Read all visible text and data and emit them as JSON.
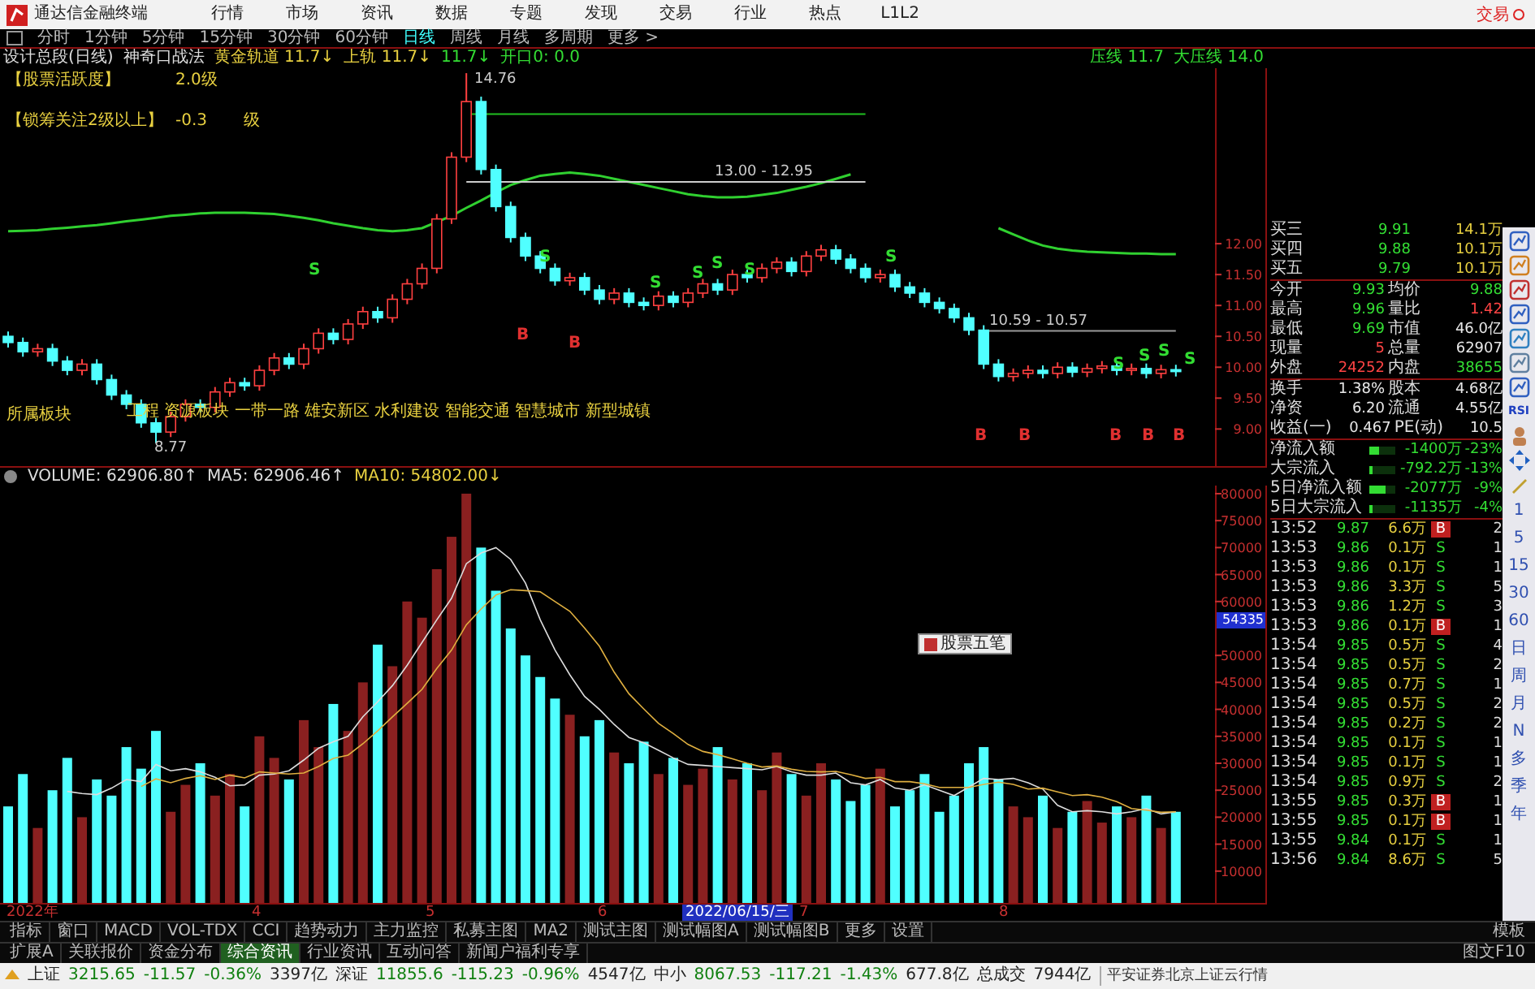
{
  "app": {
    "title": "通达信金融终端",
    "menu": [
      "行情",
      "市场",
      "资讯",
      "数据",
      "专题",
      "发现",
      "交易",
      "行业",
      "热点",
      "L1L2"
    ],
    "trade_button": "交易"
  },
  "periods": [
    {
      "label": "分时",
      "selected": false
    },
    {
      "label": "1分钟",
      "selected": false
    },
    {
      "label": "5分钟",
      "selected": false
    },
    {
      "label": "15分钟",
      "selected": false
    },
    {
      "label": "30分钟",
      "selected": false
    },
    {
      "label": "60分钟",
      "selected": false
    },
    {
      "label": "日线",
      "selected": true
    },
    {
      "label": "周线",
      "selected": false
    },
    {
      "label": "月线",
      "selected": false
    },
    {
      "label": "多周期",
      "selected": false
    },
    {
      "label": "更多 >",
      "selected": false
    }
  ],
  "indicator_bar": [
    {
      "label": "设计总段(日线)",
      "kind": "plain"
    },
    {
      "label": "神奇口战法",
      "kind": "plain"
    },
    {
      "label": "黄金轨道",
      "value": "11.7↓",
      "kind": "gold"
    },
    {
      "label": "上轨",
      "value": "11.7↓",
      "kind": "gold"
    },
    {
      "value": "11.7↓",
      "kind": "green"
    },
    {
      "label": "开口0:",
      "value": "0.0",
      "kind": "green"
    },
    {
      "label": "压线",
      "value": "11.7",
      "kind": "green-right"
    },
    {
      "label": "大压线",
      "value": "14.0",
      "kind": "green"
    }
  ],
  "notes": [
    {
      "label": "【股票活跃度】",
      "value": "2.0级"
    },
    {
      "label": "【锁筹关注2级以上】",
      "value": "-0.3",
      "unit": "级"
    }
  ],
  "price_chart": {
    "annotations": [
      "14.76",
      "13.00 - 12.95",
      "10.59 - 10.57",
      "8.77"
    ],
    "signals": [
      {
        "text": "S",
        "kind": "sell"
      },
      {
        "text": "S",
        "kind": "sell"
      },
      {
        "text": "S",
        "kind": "sell"
      },
      {
        "text": "S",
        "kind": "sell"
      },
      {
        "text": "S",
        "kind": "sell"
      },
      {
        "text": "S",
        "kind": "sell"
      },
      {
        "text": "S",
        "kind": "sell"
      },
      {
        "text": "S",
        "kind": "sell"
      },
      {
        "text": "S",
        "kind": "sell"
      },
      {
        "text": "S",
        "kind": "sell"
      },
      {
        "text": "S",
        "kind": "sell"
      },
      {
        "text": "B",
        "kind": "buy"
      },
      {
        "text": "B",
        "kind": "buy"
      },
      {
        "text": "B",
        "kind": "buy"
      },
      {
        "text": "B",
        "kind": "buy"
      },
      {
        "text": "B",
        "kind": "buy"
      },
      {
        "text": "B",
        "kind": "buy"
      },
      {
        "text": "B",
        "kind": "buy"
      }
    ],
    "concepts": {
      "label": "所属板块",
      "items": [
        "工程",
        "资源板块",
        "一带一路",
        "雄安新区",
        "水利建设",
        "智能交通",
        "智慧城市",
        "新型城镇"
      ]
    },
    "chart_data": {
      "type": "candlestick",
      "ylim": [
        8.4,
        14.84
      ],
      "series": [
        {
          "type": "line",
          "color": "#30d030",
          "values": [
            12.2,
            12.21,
            12.22,
            12.24,
            12.26,
            12.28,
            12.3,
            12.33,
            12.36,
            12.39,
            12.42,
            12.45,
            12.47,
            12.49,
            12.5,
            12.5,
            12.5,
            12.49,
            12.48,
            12.45,
            12.42,
            12.38,
            12.33,
            12.29,
            12.25,
            12.22,
            12.2,
            12.22,
            12.25,
            12.35,
            12.45,
            12.58,
            12.7,
            12.83,
            12.95,
            13.03,
            13.1,
            13.13,
            13.15,
            13.13,
            13.1,
            13.05,
            13.0,
            12.95,
            12.9,
            12.85,
            12.8,
            12.77,
            12.75,
            12.75,
            12.76,
            12.79,
            12.82,
            12.87,
            12.92,
            12.98,
            13.05,
            13.12,
            null,
            null,
            null,
            null,
            null,
            null,
            null,
            null,
            null,
            12.25,
            12.15,
            12.05,
            11.97,
            11.92,
            11.89,
            11.87,
            11.86,
            11.85,
            11.84,
            11.84,
            11.83,
            11.83
          ]
        },
        {
          "type": "line",
          "color": "#20c020",
          "values": [
            null,
            null,
            null,
            null,
            null,
            null,
            null,
            null,
            null,
            null,
            null,
            null,
            null,
            null,
            null,
            null,
            null,
            null,
            null,
            null,
            null,
            null,
            null,
            null,
            null,
            null,
            null,
            null,
            null,
            null,
            null,
            14.1,
            14.1,
            14.1,
            14.1,
            14.1,
            14.1,
            14.1,
            14.1,
            14.1,
            14.1,
            14.1,
            14.1,
            14.1,
            14.1,
            14.1,
            14.1,
            14.1,
            14.1,
            14.1,
            14.1,
            14.1,
            14.1,
            14.1,
            14.1,
            14.1,
            14.1,
            14.1,
            14.1,
            null,
            null,
            null,
            null,
            null,
            null,
            null,
            null,
            null,
            null,
            null,
            null,
            null,
            null,
            null,
            null,
            null,
            null,
            null,
            null,
            null
          ]
        },
        {
          "type": "line",
          "color": "#cccccc",
          "values": [
            null,
            null,
            null,
            null,
            null,
            null,
            null,
            null,
            null,
            null,
            null,
            null,
            null,
            null,
            null,
            null,
            null,
            null,
            null,
            null,
            null,
            null,
            null,
            null,
            null,
            null,
            null,
            null,
            null,
            null,
            null,
            13.0,
            13.0,
            13.0,
            13.0,
            13.0,
            13.0,
            13.0,
            13.0,
            13.0,
            13.0,
            13.0,
            13.0,
            13.0,
            13.0,
            13.0,
            13.0,
            13.0,
            13.0,
            13.0,
            13.0,
            13.0,
            13.0,
            13.0,
            13.0,
            13.0,
            13.0,
            13.0,
            13.0,
            null,
            null,
            null,
            null,
            null,
            null,
            null,
            null,
            null,
            null,
            null,
            null,
            null,
            null,
            null,
            null,
            null,
            null,
            null,
            null,
            null
          ]
        },
        {
          "type": "line",
          "color": "#999999",
          "values": [
            null,
            null,
            null,
            null,
            null,
            null,
            null,
            null,
            null,
            null,
            null,
            null,
            null,
            null,
            null,
            null,
            null,
            null,
            null,
            null,
            null,
            null,
            null,
            null,
            null,
            null,
            null,
            null,
            null,
            null,
            null,
            null,
            null,
            null,
            null,
            null,
            null,
            null,
            null,
            null,
            null,
            null,
            null,
            null,
            null,
            null,
            null,
            null,
            null,
            null,
            null,
            null,
            null,
            null,
            null,
            null,
            null,
            null,
            null,
            null,
            null,
            null,
            null,
            null,
            null,
            null,
            10.59,
            10.59,
            10.59,
            10.59,
            10.59,
            10.59,
            10.59,
            10.59,
            10.59,
            10.59,
            10.59,
            10.59,
            10.59,
            10.59
          ]
        }
      ],
      "yticks": [
        {
          "value": 12,
          "label": "12.00"
        },
        {
          "value": 11.5,
          "label": "11.50"
        },
        {
          "value": 11,
          "label": "11.00"
        },
        {
          "value": 10.5,
          "label": "10.50"
        },
        {
          "value": 10,
          "label": "10.00"
        },
        {
          "value": 9.5,
          "label": "9.50"
        },
        {
          "value": 9,
          "label": "9.00"
        }
      ],
      "ohlc": [
        [
          10.5,
          10.58,
          10.32,
          10.4
        ],
        [
          10.4,
          10.48,
          10.17,
          10.25
        ],
        [
          10.25,
          10.38,
          10.17,
          10.3
        ],
        [
          10.3,
          10.38,
          10.02,
          10.1
        ],
        [
          10.1,
          10.18,
          9.87,
          9.95
        ],
        [
          9.95,
          10.13,
          9.87,
          10.05
        ],
        [
          10.05,
          10.13,
          9.72,
          9.8
        ],
        [
          9.8,
          9.88,
          9.47,
          9.55
        ],
        [
          9.55,
          9.63,
          9.32,
          9.4
        ],
        [
          9.4,
          9.48,
          9.02,
          9.1
        ],
        [
          9.1,
          9.18,
          8.77,
          8.95
        ],
        [
          8.95,
          9.28,
          8.87,
          9.2
        ],
        [
          9.2,
          9.48,
          9.12,
          9.4
        ],
        [
          9.4,
          9.48,
          9.27,
          9.35
        ],
        [
          9.35,
          9.68,
          9.27,
          9.6
        ],
        [
          9.6,
          9.83,
          9.52,
          9.75
        ],
        [
          9.75,
          9.83,
          9.62,
          9.7
        ],
        [
          9.7,
          10.03,
          9.62,
          9.95
        ],
        [
          9.95,
          10.23,
          9.87,
          10.15
        ],
        [
          10.15,
          10.23,
          9.97,
          10.05
        ],
        [
          10.05,
          10.38,
          9.97,
          10.3
        ],
        [
          10.3,
          10.63,
          10.22,
          10.55
        ],
        [
          10.55,
          10.63,
          10.37,
          10.45
        ],
        [
          10.45,
          10.78,
          10.37,
          10.7
        ],
        [
          10.7,
          10.98,
          10.62,
          10.9
        ],
        [
          10.9,
          10.98,
          10.72,
          10.8
        ],
        [
          10.8,
          11.18,
          10.72,
          11.1
        ],
        [
          11.1,
          11.43,
          11.02,
          11.35
        ],
        [
          11.35,
          11.68,
          11.27,
          11.6
        ],
        [
          11.6,
          12.48,
          11.52,
          12.4
        ],
        [
          12.4,
          13.48,
          12.32,
          13.4
        ],
        [
          13.4,
          14.76,
          13.32,
          14.3
        ],
        [
          14.3,
          14.38,
          13.12,
          13.2
        ],
        [
          13.2,
          13.28,
          12.52,
          12.6
        ],
        [
          12.6,
          12.68,
          12.02,
          12.1
        ],
        [
          12.1,
          12.18,
          11.72,
          11.8
        ],
        [
          11.8,
          11.88,
          11.52,
          11.6
        ],
        [
          11.6,
          11.68,
          11.32,
          11.4
        ],
        [
          11.4,
          11.53,
          11.32,
          11.45
        ],
        [
          11.45,
          11.53,
          11.17,
          11.25
        ],
        [
          11.25,
          11.33,
          11.02,
          11.1
        ],
        [
          11.1,
          11.28,
          11.02,
          11.2
        ],
        [
          11.2,
          11.28,
          10.97,
          11.05
        ],
        [
          11.05,
          11.13,
          10.92,
          11.0
        ],
        [
          11.0,
          11.23,
          10.92,
          11.15
        ],
        [
          11.15,
          11.23,
          10.97,
          11.05
        ],
        [
          11.05,
          11.28,
          10.97,
          11.2
        ],
        [
          11.2,
          11.43,
          11.12,
          11.35
        ],
        [
          11.35,
          11.43,
          11.17,
          11.25
        ],
        [
          11.25,
          11.58,
          11.17,
          11.5
        ],
        [
          11.5,
          11.58,
          11.37,
          11.45
        ],
        [
          11.45,
          11.68,
          11.37,
          11.6
        ],
        [
          11.6,
          11.78,
          11.52,
          11.7
        ],
        [
          11.7,
          11.78,
          11.47,
          11.55
        ],
        [
          11.55,
          11.88,
          11.47,
          11.8
        ],
        [
          11.8,
          11.98,
          11.72,
          11.9
        ],
        [
          11.9,
          11.98,
          11.67,
          11.75
        ],
        [
          11.75,
          11.83,
          11.52,
          11.6
        ],
        [
          11.6,
          11.68,
          11.37,
          11.45
        ],
        [
          11.45,
          11.58,
          11.37,
          11.5
        ],
        [
          11.5,
          11.58,
          11.22,
          11.3
        ],
        [
          11.3,
          11.38,
          11.12,
          11.2
        ],
        [
          11.2,
          11.28,
          10.97,
          11.05
        ],
        [
          11.05,
          11.13,
          10.87,
          10.95
        ],
        [
          10.95,
          11.03,
          10.72,
          10.8
        ],
        [
          10.8,
          10.88,
          10.52,
          10.6
        ],
        [
          10.6,
          10.68,
          9.97,
          10.05
        ],
        [
          10.05,
          10.13,
          9.77,
          9.85
        ],
        [
          9.85,
          9.98,
          9.77,
          9.9
        ],
        [
          9.9,
          10.03,
          9.82,
          9.95
        ],
        [
          9.95,
          10.03,
          9.82,
          9.9
        ],
        [
          9.9,
          10.08,
          9.82,
          10.0
        ],
        [
          10.0,
          10.08,
          9.84,
          9.92
        ],
        [
          9.92,
          10.06,
          9.84,
          9.98
        ],
        [
          9.98,
          10.1,
          9.9,
          10.02
        ],
        [
          10.02,
          10.1,
          9.87,
          9.95
        ],
        [
          9.95,
          10.06,
          9.87,
          9.98
        ],
        [
          9.98,
          10.06,
          9.82,
          9.9
        ],
        [
          9.9,
          10.04,
          9.82,
          9.96
        ],
        [
          9.96,
          10.04,
          9.85,
          9.93
        ]
      ]
    }
  },
  "volume": {
    "header": [
      {
        "value": "62906.80↑",
        "kind": "plain"
      },
      {
        "value": "62906.46↑",
        "kind": "plain"
      },
      {
        "value": "54802.00↓",
        "kind": "gold"
      }
    ],
    "chart_data": {
      "type": "bar",
      "yticks": [
        {
          "value": 80000,
          "label": "80000"
        },
        {
          "value": 75000,
          "label": "75000"
        },
        {
          "value": 70000,
          "label": "70000"
        },
        {
          "value": 65000,
          "label": "65000"
        },
        {
          "value": 60000,
          "label": "60000"
        },
        {
          "value": 50000,
          "label": "50000"
        },
        {
          "value": 45000,
          "label": "45000"
        },
        {
          "value": 40000,
          "label": "40000"
        },
        {
          "value": 35000,
          "label": "35000"
        },
        {
          "value": 30000,
          "label": "30000"
        },
        {
          "value": 25000,
          "label": "25000"
        },
        {
          "value": 20000,
          "label": "20000"
        },
        {
          "value": 15000,
          "label": "15000"
        },
        {
          "value": 10000,
          "label": "10000"
        }
      ],
      "ylim": [
        4100,
        81500
      ],
      "categories": [
        null,
        null,
        null,
        null,
        null,
        null,
        null,
        null,
        null,
        null,
        null,
        null,
        null,
        null,
        null,
        null,
        null,
        null,
        null,
        null,
        null,
        null,
        null,
        null,
        null,
        null,
        null,
        null,
        null,
        null,
        null,
        null,
        null,
        null,
        null,
        null,
        null,
        null,
        null,
        null,
        null,
        null,
        null,
        null,
        null,
        null,
        null,
        null,
        null,
        null,
        null,
        null,
        null,
        null,
        null,
        null,
        null,
        null,
        null,
        null,
        null,
        null,
        null,
        null,
        null,
        null,
        null,
        null,
        null,
        null,
        null,
        null,
        null,
        null,
        null,
        null,
        null,
        null,
        null,
        null
      ],
      "series": [
        {
          "name": "VOLUME:",
          "type": "bar",
          "colors": [
            "#50ffff",
            "#50ffff",
            "#8a2020",
            "#50ffff",
            "#50ffff",
            "#8a2020",
            "#50ffff",
            "#50ffff",
            "#50ffff",
            "#50ffff",
            "#50ffff",
            "#8a2020",
            "#8a2020",
            "#50ffff",
            "#8a2020",
            "#8a2020",
            "#50ffff",
            "#8a2020",
            "#8a2020",
            "#50ffff",
            "#8a2020",
            "#8a2020",
            "#50ffff",
            "#8a2020",
            "#8a2020",
            "#50ffff",
            "#8a2020",
            "#8a2020",
            "#8a2020",
            "#8a2020",
            "#8a2020",
            "#8a2020",
            "#50ffff",
            "#50ffff",
            "#50ffff",
            "#50ffff",
            "#50ffff",
            "#50ffff",
            "#8a2020",
            "#50ffff",
            "#50ffff",
            "#8a2020",
            "#50ffff",
            "#50ffff",
            "#8a2020",
            "#50ffff",
            "#8a2020",
            "#8a2020",
            "#50ffff",
            "#8a2020",
            "#50ffff",
            "#8a2020",
            "#8a2020",
            "#50ffff",
            "#8a2020",
            "#8a2020",
            "#50ffff",
            "#50ffff",
            "#50ffff",
            "#8a2020",
            "#50ffff",
            "#50ffff",
            "#50ffff",
            "#50ffff",
            "#50ffff",
            "#50ffff",
            "#50ffff",
            "#50ffff",
            "#8a2020",
            "#8a2020",
            "#50ffff",
            "#8a2020",
            "#50ffff",
            "#8a2020",
            "#8a2020",
            "#50ffff",
            "#8a2020",
            "#50ffff",
            "#8a2020",
            "#50ffff"
          ],
          "values": [
            22000,
            28000,
            18000,
            25000,
            31000,
            20000,
            27000,
            24000,
            33000,
            29000,
            36000,
            21000,
            26000,
            30000,
            24000,
            28000,
            22000,
            35000,
            31000,
            27000,
            38000,
            33000,
            41000,
            36000,
            45000,
            52000,
            48000,
            60000,
            57000,
            66000,
            72000,
            80000,
            70000,
            62000,
            55000,
            50000,
            46000,
            42000,
            39000,
            35000,
            38000,
            32000,
            30000,
            34000,
            28000,
            31000,
            26000,
            29000,
            33000,
            27000,
            30000,
            25000,
            32000,
            28000,
            24000,
            30000,
            27000,
            23000,
            26000,
            29000,
            22000,
            25000,
            28000,
            21000,
            24000,
            30000,
            33000,
            27000,
            22000,
            20000,
            24000,
            18000,
            21000,
            23000,
            19000,
            22000,
            20000,
            24000,
            18000,
            21000
          ]
        },
        {
          "name": "MA5:",
          "type": "line",
          "color": "#dddddd",
          "values": [
            null,
            null,
            null,
            null,
            24800,
            24400,
            24200,
            25400,
            27000,
            26600,
            29800,
            28600,
            29000,
            28400,
            27400,
            25800,
            26000,
            27800,
            28000,
            28600,
            30600,
            32800,
            34000,
            35000,
            38600,
            41400,
            44400,
            48200,
            52400,
            56600,
            60600,
            67000,
            69000,
            70000,
            67800,
            63400,
            56600,
            51000,
            46400,
            42400,
            40000,
            37200,
            34800,
            33800,
            32400,
            31000,
            29800,
            29600,
            29400,
            29200,
            29000,
            28800,
            29400,
            28400,
            27800,
            27800,
            28200,
            26400,
            26000,
            27000,
            25400,
            25000,
            26000,
            25000,
            24000,
            25600,
            27200,
            27000,
            27200,
            26400,
            25200,
            22200,
            21000,
            21200,
            21000,
            20600,
            21000,
            21600,
            20600,
            21000
          ]
        },
        {
          "name": "MA10:",
          "type": "line",
          "color": "#e0b040",
          "values": [
            null,
            null,
            null,
            null,
            null,
            null,
            null,
            null,
            null,
            25700,
            27100,
            26400,
            27200,
            27700,
            27000,
            27800,
            27300,
            28400,
            28200,
            28000,
            28200,
            29400,
            30900,
            31500,
            33600,
            36000,
            38600,
            41100,
            43700,
            47600,
            51000,
            55700,
            58600,
            61200,
            62200,
            62000,
            61800,
            60000,
            58200,
            55100,
            51700,
            46900,
            42900,
            40100,
            37400,
            35500,
            33500,
            32200,
            31600,
            30800,
            30000,
            29300,
            29500,
            28900,
            28500,
            28400,
            28500,
            27900,
            27200,
            27400,
            26600,
            26600,
            26200,
            25500,
            25500,
            25500,
            26100,
            26500,
            26100,
            25200,
            25400,
            24700,
            24000,
            24200,
            23700,
            22900,
            21600,
            21300,
            20900,
            21000
          ]
        }
      ]
    },
    "cursor_value": "54335",
    "popup": "股票五笔"
  },
  "date_axis": [
    {
      "text": "2022年",
      "kind": "plain"
    },
    {
      "text": "4",
      "kind": "plain"
    },
    {
      "text": "5",
      "kind": "plain"
    },
    {
      "text": "6",
      "kind": "plain"
    },
    {
      "text": "2022/06/15/三",
      "kind": "cursor"
    },
    {
      "text": "7",
      "kind": "plain"
    },
    {
      "text": "8",
      "kind": "plain"
    }
  ],
  "quote": {
    "orders": [
      {
        "label": "买三",
        "price": "9.91",
        "volume": "14.1万"
      },
      {
        "label": "买四",
        "price": "9.88",
        "volume": "10.1万"
      },
      {
        "label": "买五",
        "price": "9.79",
        "volume": "10.1万"
      }
    ],
    "stats_a": [
      {
        "label": "今开",
        "value": "9.93",
        "kind": "down"
      },
      {
        "label": "均价",
        "value": "9.88",
        "kind": "down"
      },
      {
        "label": "最高",
        "value": "9.96",
        "kind": "down"
      },
      {
        "label": "量比",
        "value": "1.42",
        "kind": "up"
      },
      {
        "label": "最低",
        "value": "9.69",
        "kind": "down"
      },
      {
        "label": "市值",
        "value": "46.0亿",
        "kind": "flat"
      },
      {
        "label": "现量",
        "value": "5",
        "kind": "up"
      },
      {
        "label": "总量",
        "value": "62907",
        "kind": "flat"
      },
      {
        "label": "外盘",
        "value": "24252",
        "kind": "up"
      },
      {
        "label": "内盘",
        "value": "38655",
        "kind": "down"
      }
    ],
    "stats_b": [
      {
        "label": "换手",
        "value": "1.38%",
        "kind": "flat"
      },
      {
        "label": "股本",
        "value": "4.68亿",
        "kind": "flat"
      },
      {
        "label": "净资",
        "value": "6.20",
        "kind": "flat"
      },
      {
        "label": "流通",
        "value": "4.55亿",
        "kind": "flat"
      },
      {
        "label": "收益(一)",
        "value": "0.467",
        "kind": "flat"
      },
      {
        "label": "PE(动)",
        "value": "10.5",
        "kind": "flat"
      }
    ],
    "flows": [
      {
        "label": "净流入额",
        "value": "-1400万",
        "pct": "-23%",
        "level": 0.35
      },
      {
        "label": "大宗流入",
        "value": "-792.2万",
        "pct": "-13%",
        "level": 0.15
      },
      {
        "label": "5日净流入额",
        "value": "-2077万",
        "pct": "-9%",
        "level": 0.6
      },
      {
        "label": "5日大宗流入",
        "value": "-1135万",
        "pct": "-4%",
        "level": 0.15
      }
    ],
    "ticks": [
      {
        "time": "13:52",
        "price": "9.87",
        "volume": "6.6万",
        "side": "B",
        "kind": "buy",
        "count": "2"
      },
      {
        "time": "13:53",
        "price": "9.86",
        "volume": "0.1万",
        "side": "S",
        "kind": "sell",
        "count": "1"
      },
      {
        "time": "13:53",
        "price": "9.86",
        "volume": "0.1万",
        "side": "S",
        "kind": "sell",
        "count": "1"
      },
      {
        "time": "13:53",
        "price": "9.86",
        "volume": "3.3万",
        "side": "S",
        "kind": "sell",
        "count": "5"
      },
      {
        "time": "13:53",
        "price": "9.86",
        "volume": "1.2万",
        "side": "S",
        "kind": "sell",
        "count": "3"
      },
      {
        "time": "13:53",
        "price": "9.86",
        "volume": "0.1万",
        "side": "B",
        "kind": "buy",
        "count": "1"
      },
      {
        "time": "13:54",
        "price": "9.85",
        "volume": "0.5万",
        "side": "S",
        "kind": "sell",
        "count": "4"
      },
      {
        "time": "13:54",
        "price": "9.85",
        "volume": "0.5万",
        "side": "S",
        "kind": "sell",
        "count": "2"
      },
      {
        "time": "13:54",
        "price": "9.85",
        "volume": "0.7万",
        "side": "S",
        "kind": "sell",
        "count": "1"
      },
      {
        "time": "13:54",
        "price": "9.85",
        "volume": "0.5万",
        "side": "S",
        "kind": "sell",
        "count": "2"
      },
      {
        "time": "13:54",
        "price": "9.85",
        "volume": "0.2万",
        "side": "S",
        "kind": "sell",
        "count": "2"
      },
      {
        "time": "13:54",
        "price": "9.85",
        "volume": "0.1万",
        "side": "S",
        "kind": "sell",
        "count": "1"
      },
      {
        "time": "13:54",
        "price": "9.85",
        "volume": "0.1万",
        "side": "S",
        "kind": "sell",
        "count": "1"
      },
      {
        "time": "13:54",
        "price": "9.85",
        "volume": "0.9万",
        "side": "S",
        "kind": "sell",
        "count": "2"
      },
      {
        "time": "13:55",
        "price": "9.85",
        "volume": "0.3万",
        "side": "B",
        "kind": "buy",
        "count": "1"
      },
      {
        "time": "13:55",
        "price": "9.85",
        "volume": "0.1万",
        "side": "B",
        "kind": "buy",
        "count": "1"
      },
      {
        "time": "13:55",
        "price": "9.84",
        "volume": "0.1万",
        "side": "S",
        "kind": "sell",
        "count": "1"
      },
      {
        "time": "13:56",
        "price": "9.84",
        "volume": "8.6万",
        "side": "S",
        "kind": "sell",
        "count": "5"
      }
    ]
  },
  "toolbar": {
    "rsi": "RSI",
    "periods": [
      "1",
      "5",
      "15",
      "30",
      "60",
      "日",
      "周",
      "月",
      "N",
      "多",
      "季",
      "年"
    ]
  },
  "tabs": [
    {
      "label": "指标",
      "selected": false
    },
    {
      "label": "窗口",
      "selected": false
    },
    {
      "label": "MACD",
      "selected": false
    },
    {
      "label": "VOL-TDX",
      "selected": false
    },
    {
      "label": "CCI",
      "selected": false
    },
    {
      "label": "趋势动力",
      "selected": false
    },
    {
      "label": "主力监控",
      "selected": false
    },
    {
      "label": "私募主图",
      "selected": false
    },
    {
      "label": "MA2",
      "selected": false
    },
    {
      "label": "测试主图",
      "selected": false
    },
    {
      "label": "测试幅图A",
      "selected": false
    },
    {
      "label": "测试幅图B",
      "selected": false
    },
    {
      "label": "更多",
      "selected": false
    },
    {
      "label": "设置",
      "selected": false
    }
  ],
  "tabs_right": "模板",
  "info_tabs": [
    {
      "label": "扩展A",
      "selected": false
    },
    {
      "label": "关联报价",
      "selected": false
    },
    {
      "label": "资金分布",
      "selected": false
    },
    {
      "label": "综合资讯",
      "selected": true
    },
    {
      "label": "行业资讯",
      "selected": false
    },
    {
      "label": "互动问答",
      "selected": false
    },
    {
      "label": "新闻户福利专享",
      "selected": false
    }
  ],
  "info_right": "图文F10",
  "status_bar": {
    "indices": [
      {
        "name": "上证",
        "price": "3215.65",
        "change": "-11.57",
        "pct": "-0.36%",
        "amount": "3397亿",
        "kind": "down"
      },
      {
        "name": "深证",
        "price": "11855.6",
        "change": "-115.23",
        "pct": "-0.96%",
        "amount": "4547亿",
        "kind": "down"
      },
      {
        "name": "中小",
        "price": "8067.53",
        "change": "-117.21",
        "pct": "-1.43%",
        "amount": "677.8亿",
        "kind": "down"
      }
    ],
    "total_label": "总成交",
    "total": "7944亿",
    "server": "平安证券北京上证云行情"
  }
}
